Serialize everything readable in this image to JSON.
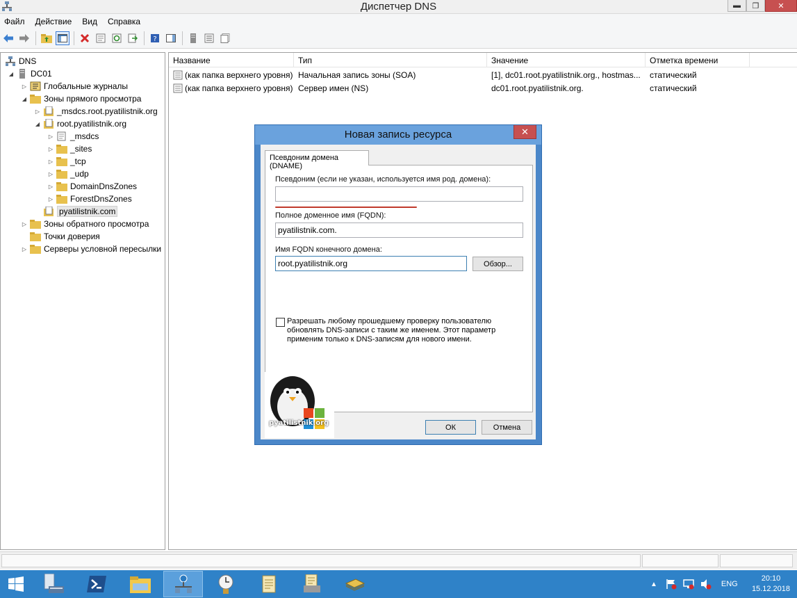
{
  "window": {
    "title": "Диспетчер DNS"
  },
  "menu": [
    "Файл",
    "Действие",
    "Вид",
    "Справка"
  ],
  "tree": {
    "root": "DNS",
    "server": "DC01",
    "global_logs": "Глобальные журналы",
    "forward_zones": "Зоны прямого просмотра",
    "msdcs_zone": "_msdcs.root.pyatilistnik.org",
    "root_zone": "root.pyatilistnik.org",
    "msdcs": "_msdcs",
    "sites": "_sites",
    "tcp": "_tcp",
    "udp": "_udp",
    "domain_dns_zones": "DomainDnsZones",
    "forest_dns_zones": "ForestDnsZones",
    "pyatilistnik_zone": "pyatilistnik.com",
    "reverse_zones": "Зоны обратного просмотра",
    "trust_points": "Точки доверия",
    "conditional_forwarders": "Серверы условной пересылки"
  },
  "list": {
    "columns": [
      "Название",
      "Тип",
      "Значение",
      "Отметка времени"
    ],
    "rows": [
      {
        "name": "(как папка верхнего уровня)",
        "type": "Начальная запись зоны (SOA)",
        "value": "[1], dc01.root.pyatilistnik.org., hostmas...",
        "timestamp": "статический"
      },
      {
        "name": "(как папка верхнего уровня)",
        "type": "Сервер имен (NS)",
        "value": "dc01.root.pyatilistnik.org.",
        "timestamp": "статический"
      }
    ]
  },
  "dialog": {
    "title": "Новая запись ресурса",
    "tab": "Псевдоним домена (DNAME)",
    "alias_label": "Псевдоним (если не указан, используется имя род. домена):",
    "alias_value": "",
    "fqdn_label": "Полное доменное имя (FQDN):",
    "fqdn_value": "pyatilistnik.com.",
    "target_label": "Имя FQDN конечного домена:",
    "target_value": "root.pyatilistnik.org",
    "browse_label": "Обзор...",
    "checkbox_line1": "Разрешать любому прошедшему проверку пользователю",
    "checkbox_line2": "обновлять DNS-записи с таким же именем. Этот параметр",
    "checkbox_line3": "применим только к DNS-записям для нового имени.",
    "ok_label": "ОК",
    "cancel_label": "Отмена",
    "logo_text": "pyatilistnik.org"
  },
  "taskbar": {
    "language": "ENG",
    "time": "20:10",
    "date": "15.12.2018"
  },
  "colors": {
    "taskbar": "#2f82c8",
    "dialog_frame": "#4b87c9",
    "close_red": "#c75050",
    "annotation_red": "#c0392b"
  }
}
